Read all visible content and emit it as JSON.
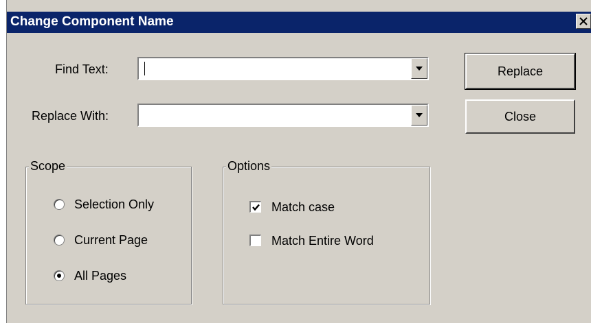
{
  "window": {
    "title": "Change Component Name"
  },
  "find": {
    "label": "Find Text:",
    "value": ""
  },
  "replace": {
    "label": "Replace With:",
    "value": ""
  },
  "buttons": {
    "replace": "Replace",
    "close": "Close"
  },
  "scope": {
    "title": "Scope",
    "options": [
      {
        "label": "Selection Only",
        "checked": false
      },
      {
        "label": "Current Page",
        "checked": false
      },
      {
        "label": "All Pages",
        "checked": true
      }
    ]
  },
  "options": {
    "title": "Options",
    "items": [
      {
        "label": "Match case",
        "checked": true
      },
      {
        "label": "Match Entire Word",
        "checked": false
      }
    ]
  },
  "colors": {
    "titlebar": "#0a246a",
    "face": "#d4d0c8"
  }
}
